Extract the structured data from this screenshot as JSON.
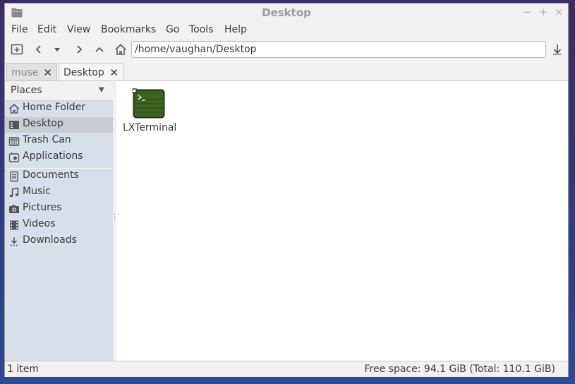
{
  "window": {
    "title": "Desktop",
    "controls": {
      "minimize": "−",
      "maximize": "+",
      "close": "×"
    }
  },
  "menubar": {
    "items": [
      "File",
      "Edit",
      "View",
      "Bookmarks",
      "Go",
      "Tools",
      "Help"
    ]
  },
  "toolbar": {
    "address": "/home/vaughan/Desktop",
    "icons": [
      "new-tab-icon",
      "back-icon",
      "history-dropdown-icon",
      "forward-icon",
      "up-icon",
      "home-icon",
      "go-icon"
    ]
  },
  "tabs": [
    {
      "label": "muse",
      "active": false,
      "close": "✕"
    },
    {
      "label": "Desktop",
      "active": true,
      "close": "✕"
    }
  ],
  "sidebar": {
    "header": "Places",
    "items": [
      {
        "label": "Home Folder",
        "icon": "home-icon"
      },
      {
        "label": "Desktop",
        "icon": "desktop-icon",
        "selected": true
      },
      {
        "label": "Trash Can",
        "icon": "trash-icon"
      },
      {
        "label": "Applications",
        "icon": "applications-icon"
      },
      {
        "label": "Documents",
        "icon": "documents-icon"
      },
      {
        "label": "Music",
        "icon": "music-icon"
      },
      {
        "label": "Pictures",
        "icon": "pictures-icon"
      },
      {
        "label": "Videos",
        "icon": "videos-icon"
      },
      {
        "label": "Downloads",
        "icon": "downloads-icon"
      }
    ]
  },
  "files": [
    {
      "label": "LXTerminal",
      "icon": "terminal-icon",
      "shortcut": true
    }
  ],
  "status": {
    "count": "1 item",
    "space": "Free space: 94.1 GiB (Total: 110.1 GiB)"
  },
  "colors": {
    "window_bg": "#f2f1f0",
    "sidebar_bg": "#d6dfea",
    "selected_bg": "#c8cdd5",
    "desktop_bg": "#2c3d82"
  }
}
